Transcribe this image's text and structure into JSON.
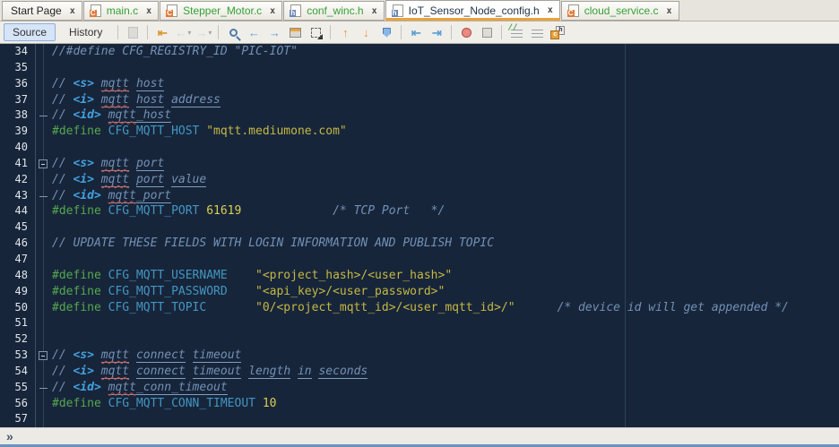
{
  "ui": {
    "close_glyph": "x",
    "breadcrumb_expand_glyph": "»"
  },
  "colors": {
    "accent_orange": "#E9A13C",
    "tab_file_green": "#35A035",
    "editor_bg": "#17253A",
    "comment": "#7291B5",
    "doc_tag": "#42A1DE",
    "preprocessor": "#55A84F",
    "identifier": "#4296C2",
    "string": "#C5B843",
    "number": "#D9CF52",
    "squiggle_red": "#C4473B",
    "source_active_bg": "#D6E4F7"
  },
  "tabs": [
    {
      "label": "Start Page",
      "kind": "plain",
      "selected": false
    },
    {
      "label": "main.c",
      "kind": "c",
      "selected": false
    },
    {
      "label": "Stepper_Motor.c",
      "kind": "c",
      "selected": false
    },
    {
      "label": "conf_winc.h",
      "kind": "h",
      "selected": false
    },
    {
      "label": "IoT_Sensor_Node_config.h",
      "kind": "h",
      "selected": true
    },
    {
      "label": "cloud_service.c",
      "kind": "c",
      "selected": false
    }
  ],
  "toolbar": {
    "source_label": "Source",
    "history_label": "History",
    "icons": [
      {
        "name": "versioning-diff-icon",
        "shape": "docpage",
        "disabled": true
      },
      {
        "sep": true
      },
      {
        "name": "last-edit-location-icon",
        "glyph": "⇤",
        "color": "#D9952F"
      },
      {
        "name": "back-icon",
        "glyph": "←",
        "color": "#B9B4A8",
        "caret": true,
        "disabled": true
      },
      {
        "name": "forward-icon",
        "glyph": "→",
        "color": "#B9B4A8",
        "caret": true,
        "disabled": true
      },
      {
        "sep": true
      },
      {
        "name": "find-selection-icon",
        "shape": "magnifier"
      },
      {
        "name": "find-previous-occurrence-icon",
        "glyph": "←",
        "color": "#5B9FD4"
      },
      {
        "name": "find-next-occurrence-icon",
        "glyph": "→",
        "color": "#5B9FD4"
      },
      {
        "name": "toggle-highlight-search-icon",
        "shape": "highlight"
      },
      {
        "name": "toggle-rectangular-selection-icon",
        "shape": "rectselect"
      },
      {
        "sep": true
      },
      {
        "name": "previous-bookmark-icon",
        "glyph": "↑",
        "color": "#E59A35"
      },
      {
        "name": "next-bookmark-icon",
        "glyph": "↓",
        "color": "#E59A35"
      },
      {
        "name": "toggle-bookmark-icon",
        "shape": "flag"
      },
      {
        "sep": true
      },
      {
        "name": "shift-line-left-icon",
        "glyph": "⇤",
        "color": "#5B9FD4"
      },
      {
        "name": "shift-line-right-icon",
        "glyph": "⇥",
        "color": "#5B9FD4"
      },
      {
        "sep": true
      },
      {
        "name": "record-macro-icon",
        "shape": "record"
      },
      {
        "name": "stop-macro-icon",
        "shape": "stop"
      },
      {
        "sep": true
      },
      {
        "name": "comment-icon",
        "shape": "comment"
      },
      {
        "name": "uncomment-icon",
        "shape": "uncomment"
      },
      {
        "name": "toggle-header-source-icon",
        "shape": "headersource"
      }
    ]
  },
  "editor": {
    "lines": [
      {
        "n": "34",
        "fold": "",
        "seg": [
          [
            "//#define CFG_REGISTRY_ID \"PIC-IOT\"",
            "cm"
          ]
        ]
      },
      {
        "n": "35",
        "fold": "",
        "seg": []
      },
      {
        "n": "36",
        "fold": "",
        "seg": [
          [
            "// ",
            "cm"
          ],
          [
            "<s>",
            "tag"
          ],
          [
            " ",
            "cm"
          ],
          [
            "mqtt",
            "cm u sq"
          ],
          [
            " ",
            "cm"
          ],
          [
            "host",
            "cm u"
          ]
        ]
      },
      {
        "n": "37",
        "fold": "",
        "seg": [
          [
            "// ",
            "cm"
          ],
          [
            "<i>",
            "tag"
          ],
          [
            " ",
            "cm"
          ],
          [
            "mqtt",
            "cm u sq"
          ],
          [
            " ",
            "cm"
          ],
          [
            "host",
            "cm u"
          ],
          [
            " ",
            "cm"
          ],
          [
            "address",
            "cm u"
          ]
        ]
      },
      {
        "n": "38",
        "fold": "end",
        "seg": [
          [
            "// ",
            "cm"
          ],
          [
            "<id>",
            "tag"
          ],
          [
            " ",
            "cm"
          ],
          [
            "mqtt",
            "cm u sq"
          ],
          [
            "_host",
            "cm u"
          ]
        ]
      },
      {
        "n": "39",
        "fold": "",
        "seg": [
          [
            "#define",
            "pp"
          ],
          [
            " ",
            "sp"
          ],
          [
            "CFG_MQTT_HOST",
            "id"
          ],
          [
            " ",
            "sp"
          ],
          [
            "\"mqtt.mediumone.com\"",
            "str"
          ]
        ]
      },
      {
        "n": "40",
        "fold": "",
        "seg": []
      },
      {
        "n": "41",
        "fold": "box",
        "seg": [
          [
            "// ",
            "cm"
          ],
          [
            "<s>",
            "tag"
          ],
          [
            " ",
            "cm"
          ],
          [
            "mqtt",
            "cm u sq"
          ],
          [
            " ",
            "cm"
          ],
          [
            "port",
            "cm u"
          ]
        ]
      },
      {
        "n": "42",
        "fold": "",
        "seg": [
          [
            "// ",
            "cm"
          ],
          [
            "<i>",
            "tag"
          ],
          [
            " ",
            "cm"
          ],
          [
            "mqtt",
            "cm u sq"
          ],
          [
            " ",
            "cm"
          ],
          [
            "port",
            "cm u"
          ],
          [
            " ",
            "cm"
          ],
          [
            "value",
            "cm u"
          ]
        ]
      },
      {
        "n": "43",
        "fold": "end",
        "seg": [
          [
            "// ",
            "cm"
          ],
          [
            "<id>",
            "tag"
          ],
          [
            " ",
            "cm"
          ],
          [
            "mqtt",
            "cm u sq"
          ],
          [
            "_port",
            "cm u"
          ]
        ]
      },
      {
        "n": "44",
        "fold": "",
        "seg": [
          [
            "#define",
            "pp"
          ],
          [
            " ",
            "sp"
          ],
          [
            "CFG_MQTT_PORT",
            "id"
          ],
          [
            " ",
            "sp"
          ],
          [
            "61619",
            "num"
          ],
          [
            "             ",
            "sp"
          ],
          [
            "/* TCP Port   */",
            "cm"
          ]
        ]
      },
      {
        "n": "45",
        "fold": "",
        "seg": []
      },
      {
        "n": "46",
        "fold": "",
        "seg": [
          [
            "// UPDATE THESE FIELDS WITH LOGIN INFORMATION AND PUBLISH TOPIC",
            "cm"
          ]
        ]
      },
      {
        "n": "47",
        "fold": "",
        "seg": []
      },
      {
        "n": "48",
        "fold": "",
        "seg": [
          [
            "#define",
            "pp"
          ],
          [
            " ",
            "sp"
          ],
          [
            "CFG_MQTT_USERNAME",
            "id"
          ],
          [
            "    ",
            "sp"
          ],
          [
            "\"<project_hash>/<user_hash>\"",
            "str"
          ]
        ]
      },
      {
        "n": "49",
        "fold": "",
        "seg": [
          [
            "#define",
            "pp"
          ],
          [
            " ",
            "sp"
          ],
          [
            "CFG_MQTT_PASSWORD",
            "id"
          ],
          [
            "    ",
            "sp"
          ],
          [
            "\"<api_key>/<user_password>\"",
            "str"
          ]
        ]
      },
      {
        "n": "50",
        "fold": "",
        "seg": [
          [
            "#define",
            "pp"
          ],
          [
            " ",
            "sp"
          ],
          [
            "CFG_MQTT_TOPIC",
            "id"
          ],
          [
            "       ",
            "sp"
          ],
          [
            "\"0/<project_mqtt_id>/<user_mqtt_id>/\"",
            "str"
          ],
          [
            "      ",
            "sp"
          ],
          [
            "/* device id will get appended */",
            "cm"
          ]
        ]
      },
      {
        "n": "51",
        "fold": "",
        "seg": []
      },
      {
        "n": "52",
        "fold": "",
        "seg": []
      },
      {
        "n": "53",
        "fold": "box",
        "seg": [
          [
            "// ",
            "cm"
          ],
          [
            "<s>",
            "tag"
          ],
          [
            " ",
            "cm"
          ],
          [
            "mqtt",
            "cm u sq"
          ],
          [
            " ",
            "cm"
          ],
          [
            "connect",
            "cm u"
          ],
          [
            " ",
            "cm"
          ],
          [
            "timeout",
            "cm u"
          ]
        ]
      },
      {
        "n": "54",
        "fold": "",
        "seg": [
          [
            "// ",
            "cm"
          ],
          [
            "<i>",
            "tag"
          ],
          [
            " ",
            "cm"
          ],
          [
            "mqtt",
            "cm u sq"
          ],
          [
            " ",
            "cm"
          ],
          [
            "connect",
            "cm u"
          ],
          [
            " ",
            "cm"
          ],
          [
            "timeout",
            "cm u"
          ],
          [
            " ",
            "cm"
          ],
          [
            "length",
            "cm u"
          ],
          [
            " ",
            "cm"
          ],
          [
            "in",
            "cm u"
          ],
          [
            " ",
            "cm"
          ],
          [
            "seconds",
            "cm u"
          ]
        ]
      },
      {
        "n": "55",
        "fold": "end",
        "seg": [
          [
            "// ",
            "cm"
          ],
          [
            "<id>",
            "tag"
          ],
          [
            " ",
            "cm"
          ],
          [
            "mqtt",
            "cm u sq"
          ],
          [
            "_conn_timeout",
            "cm u"
          ]
        ]
      },
      {
        "n": "56",
        "fold": "",
        "seg": [
          [
            "#define",
            "pp"
          ],
          [
            " ",
            "sp"
          ],
          [
            "CFG_MQTT_CONN_TIMEOUT",
            "id"
          ],
          [
            " ",
            "sp"
          ],
          [
            "10",
            "num"
          ]
        ]
      },
      {
        "n": "57",
        "fold": "",
        "seg": []
      }
    ]
  }
}
